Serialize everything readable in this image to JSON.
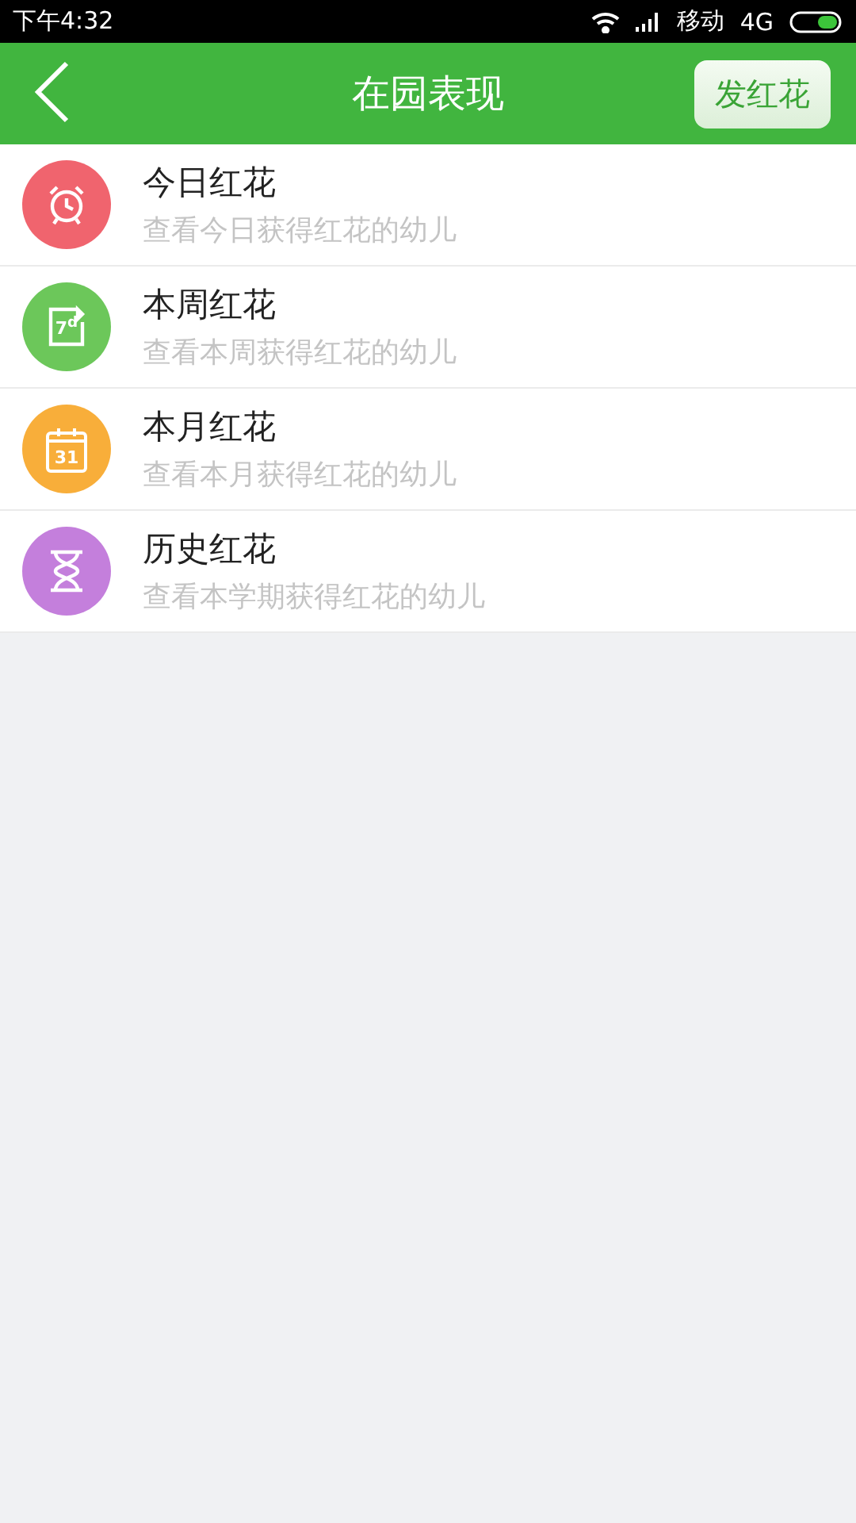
{
  "status_bar": {
    "time": "下午4:32",
    "carrier": "移动",
    "network": "4G"
  },
  "header": {
    "title": "在园表现",
    "action": "发红花"
  },
  "items": [
    {
      "kind": "alarm",
      "color": "#f0646e",
      "title": "今日红花",
      "subtitle": "查看今日获得红花的幼儿"
    },
    {
      "kind": "week",
      "color": "#6cc75a",
      "icon_text": "7$^{d}$",
      "title": "本周红花",
      "subtitle": "查看本周获得红花的幼儿"
    },
    {
      "kind": "calendar",
      "color": "#f8ae3a",
      "icon_text": "31",
      "title": "本月红花",
      "subtitle": "查看本月获得红花的幼儿"
    },
    {
      "kind": "hourglass",
      "color": "#c47fdc",
      "title": "历史红花",
      "subtitle": "查看本学期获得红花的幼儿"
    }
  ]
}
